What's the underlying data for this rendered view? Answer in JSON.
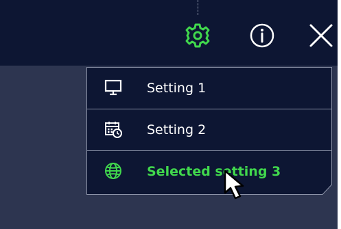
{
  "toolbar": {
    "buttons": [
      {
        "name": "settings",
        "icon": "gear-icon",
        "active": true
      },
      {
        "name": "info",
        "icon": "info-icon"
      },
      {
        "name": "close",
        "icon": "close-icon"
      }
    ]
  },
  "menu": {
    "items": [
      {
        "label": "Setting 1",
        "icon": "monitor-icon",
        "selected": false
      },
      {
        "label": "Setting 2",
        "icon": "calendar-clock-icon",
        "selected": false
      },
      {
        "label": "Selected setting 3",
        "icon": "globe-icon",
        "selected": true
      }
    ]
  },
  "colors": {
    "topbar_bg": "#0d1633",
    "panel_bg": "#2d3550",
    "accent_green": "#41d84d",
    "menu_border": "#8c93a8",
    "text": "#ffffff"
  }
}
